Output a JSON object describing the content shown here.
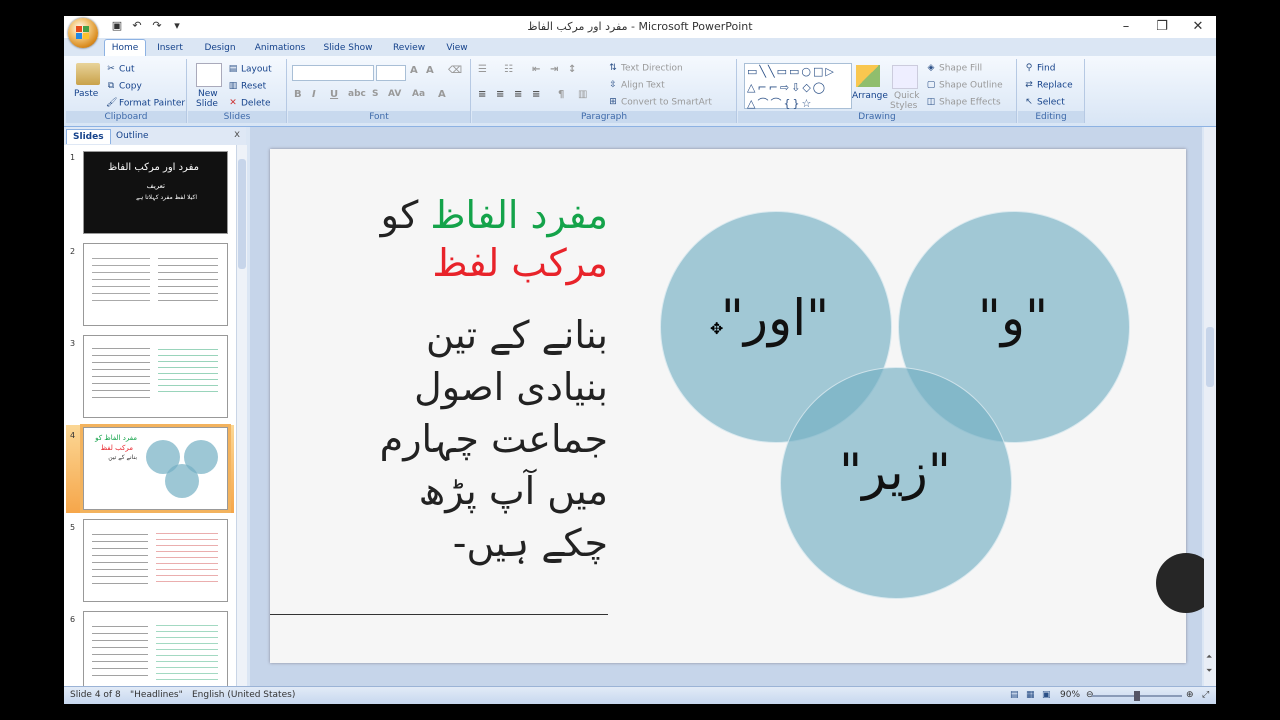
{
  "window": {
    "title": "مفرد اور مرکب الفاظ - Microsoft PowerPoint",
    "controls": [
      "–",
      "❐",
      "✕"
    ]
  },
  "tabs": [
    "Home",
    "Insert",
    "Design",
    "Animations",
    "Slide Show",
    "Review",
    "View"
  ],
  "ribbon": {
    "clipboard": {
      "label": "Clipboard",
      "paste": "Paste",
      "cut": "Cut",
      "copy": "Copy",
      "format_painter": "Format Painter"
    },
    "slides": {
      "label": "Slides",
      "new_slide": "New",
      "new_slide2": "Slide",
      "layout": "Layout",
      "reset": "Reset",
      "delete": "Delete"
    },
    "font": {
      "label": "Font"
    },
    "paragraph": {
      "label": "Paragraph",
      "text_direction": "Text Direction",
      "align_text": "Align Text",
      "convert": "Convert to SmartArt"
    },
    "drawing": {
      "label": "Drawing",
      "arrange": "Arrange",
      "quick_styles": "Quick",
      "quick_styles2": "Styles",
      "shape_fill": "Shape Fill",
      "shape_outline": "Shape Outline",
      "shape_effects": "Shape Effects"
    },
    "editing": {
      "label": "Editing",
      "find": "Find",
      "replace": "Replace",
      "select": "Select"
    }
  },
  "sidebar": {
    "tabs": [
      "Slides",
      "Outline"
    ],
    "close": "x",
    "thumbs": [
      {
        "num": "1",
        "title": "مفرد اور مرکب الفاظ",
        "sub1": "تعریف",
        "sub2": "اکیلا لفظ مفرد کہلاتا ہے"
      },
      {
        "num": "2"
      },
      {
        "num": "3"
      },
      {
        "num": "4",
        "title": "مفرد الفاظ کو",
        "sub1": "مرکب لفظ",
        "sub2": "بنانے کے تین"
      },
      {
        "num": "5"
      },
      {
        "num": "6"
      }
    ]
  },
  "slide": {
    "line1_part1": "مفرد الفاظ",
    "line1_part2": " کو",
    "line2": "مرکب لفظ",
    "body": [
      "بنانے کے تین",
      "بنیادی  اصول",
      "جماعت چہارم",
      "میں آپ پڑھ",
      "چکے ہیں-"
    ],
    "circles": [
      {
        "label": "\"اور\""
      },
      {
        "label": "\"و\""
      },
      {
        "label": "\"زیر\""
      }
    ],
    "circle_color": "#73afc3"
  },
  "status": {
    "slide": "Slide 4 of 8",
    "theme": "\"Headlines\"",
    "language": "English (United States)",
    "zoom": "90%"
  }
}
